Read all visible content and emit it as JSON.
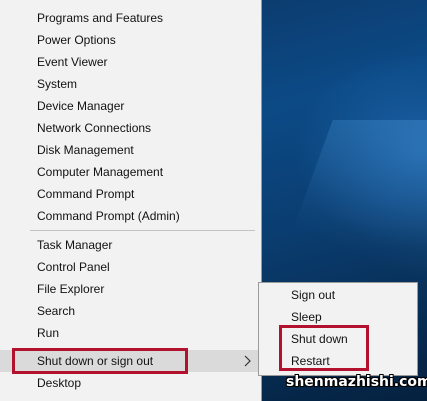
{
  "menu": {
    "group1": [
      "Programs and Features",
      "Power Options",
      "Event Viewer",
      "System",
      "Device Manager",
      "Network Connections",
      "Disk Management",
      "Computer Management",
      "Command Prompt",
      "Command Prompt (Admin)"
    ],
    "group2": [
      "Task Manager",
      "Control Panel",
      "File Explorer",
      "Search",
      "Run",
      "Shut down or sign out",
      "Desktop"
    ]
  },
  "submenu": {
    "items": [
      "Sign out",
      "Sleep",
      "Shut down",
      "Restart"
    ]
  },
  "colors": {
    "annotation": "#b3122e",
    "menu_bg": "#f2f2f2",
    "highlight": "#dadada"
  },
  "watermark": "shenmazhishi.com"
}
